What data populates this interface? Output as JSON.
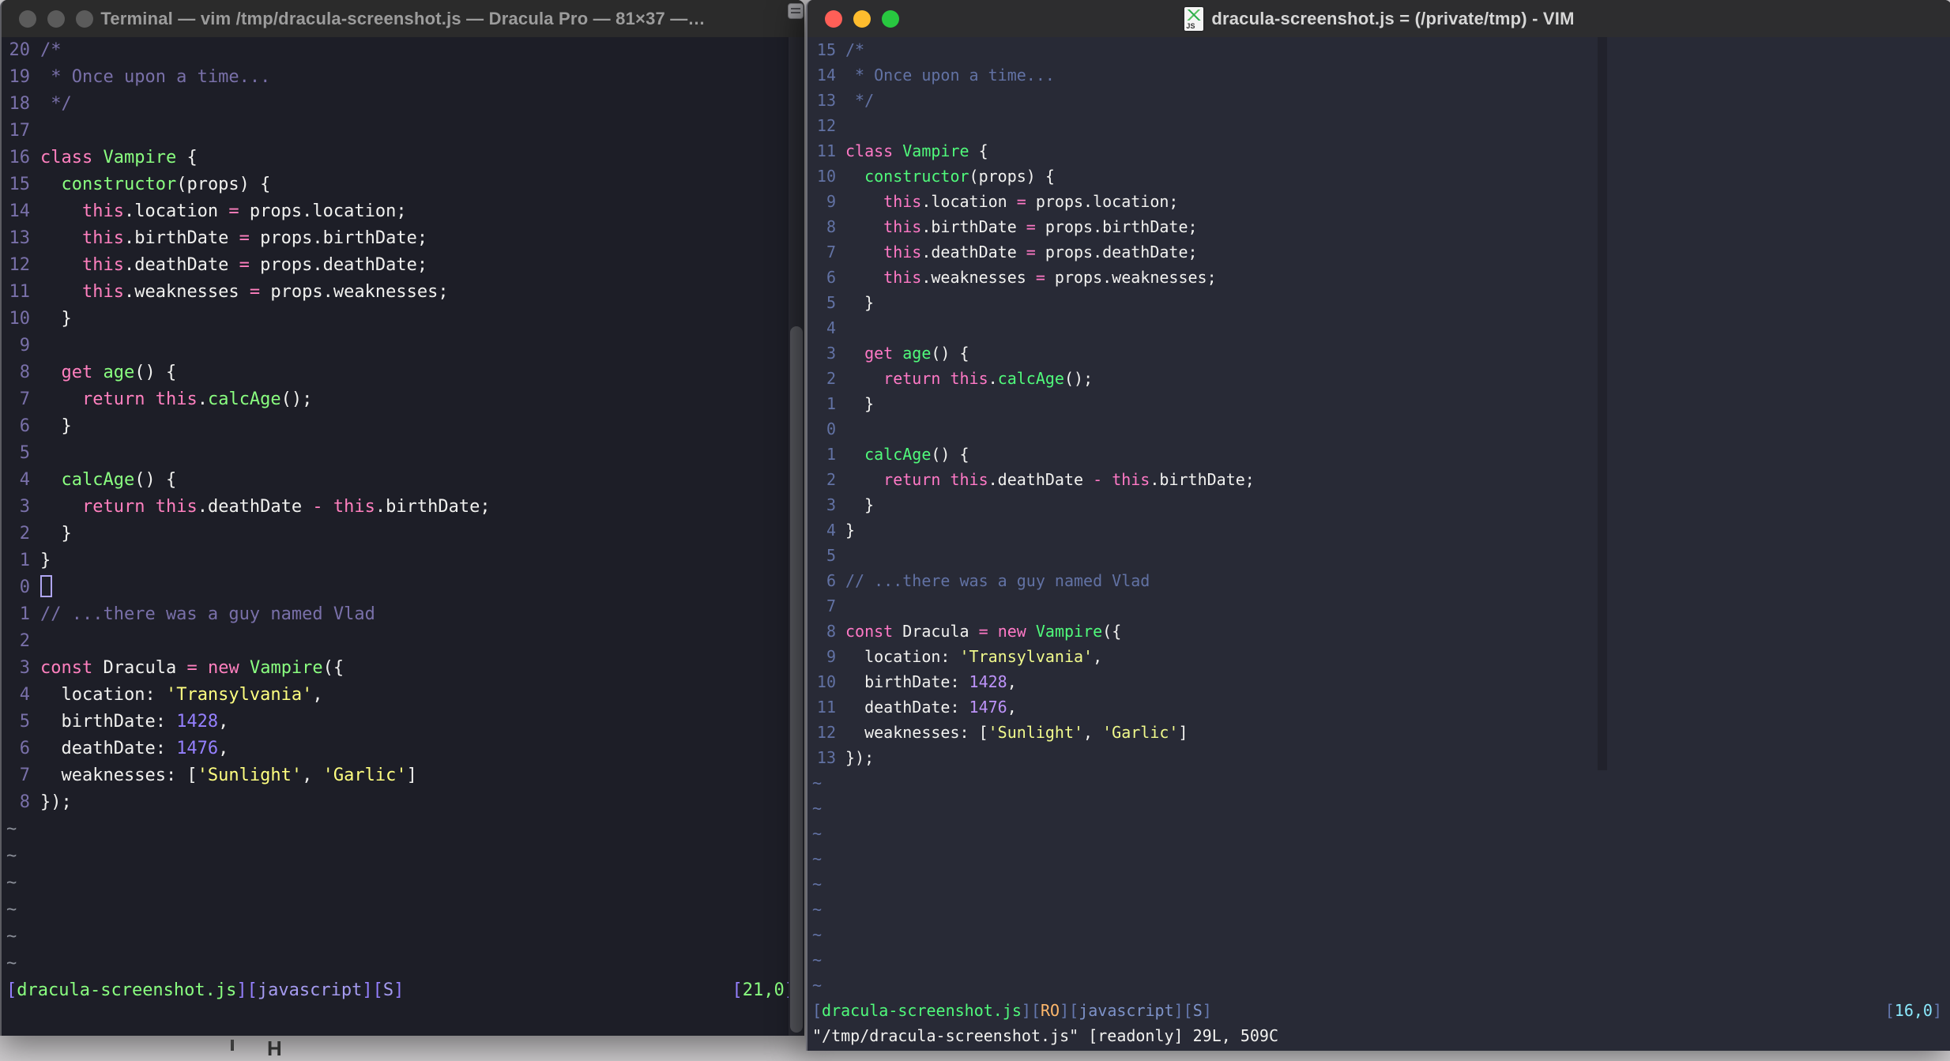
{
  "desktop": {
    "bg": "#cfcdcf"
  },
  "left_window": {
    "title": "Terminal — vim /tmp/dracula-screenshot.js — Dracula Pro — 81×37 —…",
    "traffic_lights": [
      "close",
      "minimize",
      "zoom"
    ],
    "theme": {
      "bg": "#1d1e27",
      "fg": "#f1f1ef",
      "comment": "#7970a9",
      "linenr": "#7970a9",
      "pink": "#ff80bf",
      "green": "#8aff80",
      "yellow": "#ffff80",
      "purple": "#9580ff",
      "br": "#9580ff",
      "tag": "#a59bf0",
      "file": "#8aff80",
      "pos": "#8aff80",
      "cursor": "#b0a6f2",
      "cc": "#1d1e27"
    },
    "tilde": "~",
    "tilde_rows": 6,
    "lines": [
      {
        "n": "20",
        "s": [
          [
            "c",
            "/*"
          ]
        ]
      },
      {
        "n": "19",
        "s": [
          [
            "c",
            " * Once upon a time..."
          ]
        ]
      },
      {
        "n": "18",
        "s": [
          [
            "c",
            " */"
          ]
        ]
      },
      {
        "n": "17",
        "s": []
      },
      {
        "n": "16",
        "s": [
          [
            "k",
            "class"
          ],
          [
            "w",
            " "
          ],
          [
            "f",
            "Vampire"
          ],
          [
            "w",
            " {"
          ]
        ]
      },
      {
        "n": "15",
        "s": [
          [
            "w",
            "  "
          ],
          [
            "f",
            "constructor"
          ],
          [
            "w",
            "(props) {"
          ]
        ]
      },
      {
        "n": "14",
        "s": [
          [
            "w",
            "    "
          ],
          [
            "k",
            "this"
          ],
          [
            "w",
            ".location "
          ],
          [
            "o",
            "="
          ],
          [
            "w",
            " props.location;"
          ]
        ]
      },
      {
        "n": "13",
        "s": [
          [
            "w",
            "    "
          ],
          [
            "k",
            "this"
          ],
          [
            "w",
            ".birthDate "
          ],
          [
            "o",
            "="
          ],
          [
            "w",
            " props.birthDate;"
          ]
        ]
      },
      {
        "n": "12",
        "s": [
          [
            "w",
            "    "
          ],
          [
            "k",
            "this"
          ],
          [
            "w",
            ".deathDate "
          ],
          [
            "o",
            "="
          ],
          [
            "w",
            " props.deathDate;"
          ]
        ]
      },
      {
        "n": "11",
        "s": [
          [
            "w",
            "    "
          ],
          [
            "k",
            "this"
          ],
          [
            "w",
            ".weaknesses "
          ],
          [
            "o",
            "="
          ],
          [
            "w",
            " props.weaknesses;"
          ]
        ]
      },
      {
        "n": "10",
        "s": [
          [
            "w",
            "  }"
          ]
        ]
      },
      {
        "n": "9",
        "s": []
      },
      {
        "n": "8",
        "s": [
          [
            "w",
            "  "
          ],
          [
            "k",
            "get"
          ],
          [
            "w",
            " "
          ],
          [
            "f",
            "age"
          ],
          [
            "w",
            "() {"
          ]
        ]
      },
      {
        "n": "7",
        "s": [
          [
            "w",
            "    "
          ],
          [
            "k",
            "return"
          ],
          [
            "w",
            " "
          ],
          [
            "k",
            "this"
          ],
          [
            "w",
            "."
          ],
          [
            "f",
            "calcAge"
          ],
          [
            "w",
            "();"
          ]
        ]
      },
      {
        "n": "6",
        "s": [
          [
            "w",
            "  }"
          ]
        ]
      },
      {
        "n": "5",
        "s": []
      },
      {
        "n": "4",
        "s": [
          [
            "w",
            "  "
          ],
          [
            "f",
            "calcAge"
          ],
          [
            "w",
            "() {"
          ]
        ]
      },
      {
        "n": "3",
        "s": [
          [
            "w",
            "    "
          ],
          [
            "k",
            "return"
          ],
          [
            "w",
            " "
          ],
          [
            "k",
            "this"
          ],
          [
            "w",
            ".deathDate "
          ],
          [
            "o",
            "-"
          ],
          [
            "w",
            " "
          ],
          [
            "k",
            "this"
          ],
          [
            "w",
            ".birthDate;"
          ]
        ]
      },
      {
        "n": "2",
        "s": [
          [
            "w",
            "  }"
          ]
        ]
      },
      {
        "n": "1",
        "s": [
          [
            "w",
            "}"
          ]
        ]
      },
      {
        "n": "0",
        "s": [],
        "cursor": true
      },
      {
        "n": "1",
        "s": [
          [
            "c",
            "// ...there was a guy named Vlad"
          ]
        ]
      },
      {
        "n": "2",
        "s": []
      },
      {
        "n": "3",
        "s": [
          [
            "k",
            "const"
          ],
          [
            "w",
            " Dracula "
          ],
          [
            "o",
            "="
          ],
          [
            "w",
            " "
          ],
          [
            "k",
            "new"
          ],
          [
            "w",
            " "
          ],
          [
            "f",
            "Vampire"
          ],
          [
            "w",
            "({"
          ]
        ]
      },
      {
        "n": "4",
        "s": [
          [
            "w",
            "  location: "
          ],
          [
            "s",
            "'Transylvania'"
          ],
          [
            "w",
            ","
          ]
        ]
      },
      {
        "n": "5",
        "s": [
          [
            "w",
            "  birthDate: "
          ],
          [
            "n",
            "1428"
          ],
          [
            "w",
            ","
          ]
        ]
      },
      {
        "n": "6",
        "s": [
          [
            "w",
            "  deathDate: "
          ],
          [
            "n",
            "1476"
          ],
          [
            "w",
            ","
          ]
        ]
      },
      {
        "n": "7",
        "s": [
          [
            "w",
            "  weaknesses: ["
          ],
          [
            "s",
            "'Sunlight'"
          ],
          [
            "w",
            ", "
          ],
          [
            "s",
            "'Garlic'"
          ],
          [
            "w",
            "]"
          ]
        ]
      },
      {
        "n": "8",
        "s": [
          [
            "w",
            "});"
          ]
        ]
      }
    ],
    "status_left": [
      [
        "lb",
        "["
      ],
      [
        "lf",
        "dracula-screenshot.js"
      ],
      [
        "lb",
        "]["
      ],
      [
        "lt",
        "javascript"
      ],
      [
        "lb",
        "]["
      ],
      [
        "lt",
        "S"
      ],
      [
        "lb",
        "]"
      ]
    ],
    "status_right": [
      [
        "lb",
        "["
      ],
      [
        "lp",
        "21,0"
      ],
      [
        "lb",
        "]"
      ]
    ],
    "ruler": ""
  },
  "right_window": {
    "title": "dracula-screenshot.js = (/private/tmp) - VIM",
    "traffic_lights": [
      "close",
      "minimize",
      "zoom"
    ],
    "traffic_light_colors": {
      "close": "#ff5f57",
      "minimize": "#febc2e",
      "zoom": "#28c840"
    },
    "file_icon": "js-document-icon",
    "theme": {
      "bg": "#282a36",
      "fg": "#f2f2f0",
      "comment": "#6272a4",
      "linenr": "#6272a4",
      "pink": "#ff79c6",
      "green": "#50fa7b",
      "yellow": "#f1fa8c",
      "purple": "#bd93f9",
      "br": "#6477ad",
      "tag": "#7e93c9",
      "file": "#50fa7b",
      "pos": "#8be9fd",
      "ro": "#ffb86c",
      "cursor": "#f8f8f2",
      "cc": "#21222c"
    },
    "tilde": "~",
    "tilde_rows": 9,
    "lines": [
      {
        "n": "15",
        "s": [
          [
            "c",
            "/*"
          ]
        ]
      },
      {
        "n": "14",
        "s": [
          [
            "c",
            " * Once upon a time..."
          ]
        ]
      },
      {
        "n": "13",
        "s": [
          [
            "c",
            " */"
          ]
        ]
      },
      {
        "n": "12",
        "s": []
      },
      {
        "n": "11",
        "s": [
          [
            "k",
            "class"
          ],
          [
            "w",
            " "
          ],
          [
            "f",
            "Vampire"
          ],
          [
            "w",
            " {"
          ]
        ]
      },
      {
        "n": "10",
        "s": [
          [
            "w",
            "  "
          ],
          [
            "f",
            "constructor"
          ],
          [
            "w",
            "(props) {"
          ]
        ]
      },
      {
        "n": "9",
        "s": [
          [
            "w",
            "    "
          ],
          [
            "k",
            "this"
          ],
          [
            "w",
            ".location "
          ],
          [
            "o",
            "="
          ],
          [
            "w",
            " props.location;"
          ]
        ]
      },
      {
        "n": "8",
        "s": [
          [
            "w",
            "    "
          ],
          [
            "k",
            "this"
          ],
          [
            "w",
            ".birthDate "
          ],
          [
            "o",
            "="
          ],
          [
            "w",
            " props.birthDate;"
          ]
        ]
      },
      {
        "n": "7",
        "s": [
          [
            "w",
            "    "
          ],
          [
            "k",
            "this"
          ],
          [
            "w",
            ".deathDate "
          ],
          [
            "o",
            "="
          ],
          [
            "w",
            " props.deathDate;"
          ]
        ]
      },
      {
        "n": "6",
        "s": [
          [
            "w",
            "    "
          ],
          [
            "k",
            "this"
          ],
          [
            "w",
            ".weaknesses "
          ],
          [
            "o",
            "="
          ],
          [
            "w",
            " props.weaknesses;"
          ]
        ]
      },
      {
        "n": "5",
        "s": [
          [
            "w",
            "  }"
          ]
        ]
      },
      {
        "n": "4",
        "s": []
      },
      {
        "n": "3",
        "s": [
          [
            "w",
            "  "
          ],
          [
            "k",
            "get"
          ],
          [
            "w",
            " "
          ],
          [
            "f",
            "age"
          ],
          [
            "w",
            "() {"
          ]
        ]
      },
      {
        "n": "2",
        "s": [
          [
            "w",
            "    "
          ],
          [
            "k",
            "return"
          ],
          [
            "w",
            " "
          ],
          [
            "k",
            "this"
          ],
          [
            "w",
            "."
          ],
          [
            "f",
            "calcAge"
          ],
          [
            "w",
            "();"
          ]
        ]
      },
      {
        "n": "1",
        "s": [
          [
            "w",
            "  }"
          ]
        ]
      },
      {
        "n": "0",
        "s": []
      },
      {
        "n": "1",
        "s": [
          [
            "w",
            "  "
          ],
          [
            "f",
            "calcAge"
          ],
          [
            "w",
            "() {"
          ]
        ]
      },
      {
        "n": "2",
        "s": [
          [
            "w",
            "    "
          ],
          [
            "k",
            "return"
          ],
          [
            "w",
            " "
          ],
          [
            "k",
            "this"
          ],
          [
            "w",
            ".deathDate "
          ],
          [
            "o",
            "-"
          ],
          [
            "w",
            " "
          ],
          [
            "k",
            "this"
          ],
          [
            "w",
            ".birthDate;"
          ]
        ]
      },
      {
        "n": "3",
        "s": [
          [
            "w",
            "  }"
          ]
        ]
      },
      {
        "n": "4",
        "s": [
          [
            "w",
            "}"
          ]
        ]
      },
      {
        "n": "5",
        "s": []
      },
      {
        "n": "6",
        "s": [
          [
            "c",
            "// ...there was a guy named Vlad"
          ]
        ]
      },
      {
        "n": "7",
        "s": []
      },
      {
        "n": "8",
        "s": [
          [
            "k",
            "const"
          ],
          [
            "w",
            " Dracula "
          ],
          [
            "o",
            "="
          ],
          [
            "w",
            " "
          ],
          [
            "k",
            "new"
          ],
          [
            "w",
            " "
          ],
          [
            "f",
            "Vampire"
          ],
          [
            "w",
            "({"
          ]
        ]
      },
      {
        "n": "9",
        "s": [
          [
            "w",
            "  location: "
          ],
          [
            "s",
            "'Transylvania'"
          ],
          [
            "w",
            ","
          ]
        ]
      },
      {
        "n": "10",
        "s": [
          [
            "w",
            "  birthDate: "
          ],
          [
            "n",
            "1428"
          ],
          [
            "w",
            ","
          ]
        ]
      },
      {
        "n": "11",
        "s": [
          [
            "w",
            "  deathDate: "
          ],
          [
            "n",
            "1476"
          ],
          [
            "w",
            ","
          ]
        ]
      },
      {
        "n": "12",
        "s": [
          [
            "w",
            "  weaknesses: ["
          ],
          [
            "s",
            "'Sunlight'"
          ],
          [
            "w",
            ", "
          ],
          [
            "s",
            "'Garlic'"
          ],
          [
            "w",
            "]"
          ]
        ]
      },
      {
        "n": "13",
        "s": [
          [
            "w",
            "});"
          ]
        ]
      }
    ],
    "status_left": [
      [
        "lb",
        "["
      ],
      [
        "lf",
        "dracula-screenshot.js"
      ],
      [
        "lb",
        "]["
      ],
      [
        "ro",
        "RO"
      ],
      [
        "lb",
        "]["
      ],
      [
        "lt",
        "javascript"
      ],
      [
        "lb",
        "]["
      ],
      [
        "lt",
        "S"
      ],
      [
        "lb",
        "]"
      ]
    ],
    "status_right": [
      [
        "lb",
        "["
      ],
      [
        "lp",
        "16,0"
      ],
      [
        "lb",
        "]"
      ]
    ],
    "ruler": "\"/tmp/dracula-screenshot.js\" [readonly] 29L, 509C"
  }
}
